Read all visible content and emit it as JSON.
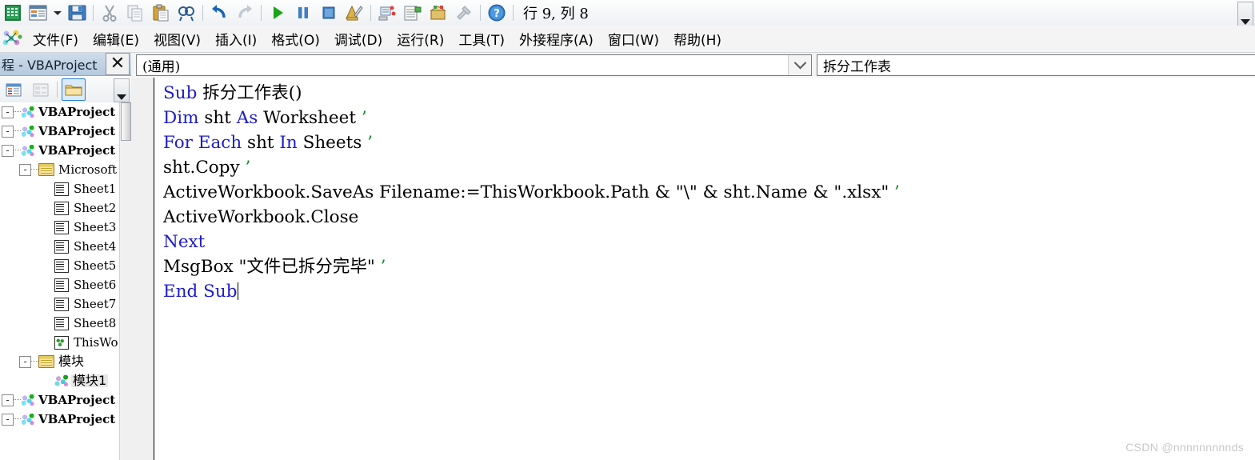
{
  "toolbar": {
    "buttons": [
      {
        "name": "excel-logo-icon",
        "glyph": "excel"
      },
      {
        "name": "view-microsoft-excel-icon",
        "glyph": "viewexcel"
      },
      {
        "name": "insert-dropdown-caret-icon",
        "glyph": "caret"
      },
      {
        "name": "save-icon",
        "glyph": "save"
      },
      {
        "name": "cut-icon",
        "glyph": "cut"
      },
      {
        "name": "copy-icon",
        "glyph": "copy"
      },
      {
        "name": "paste-icon",
        "glyph": "paste"
      },
      {
        "name": "find-icon",
        "glyph": "find"
      },
      {
        "name": "undo-icon",
        "glyph": "undo"
      },
      {
        "name": "redo-icon",
        "glyph": "redo"
      },
      {
        "name": "run-icon",
        "glyph": "run"
      },
      {
        "name": "break-icon",
        "glyph": "pause"
      },
      {
        "name": "reset-icon",
        "glyph": "stop"
      },
      {
        "name": "design-mode-icon",
        "glyph": "design"
      },
      {
        "name": "project-explorer-icon",
        "glyph": "projexp"
      },
      {
        "name": "properties-window-icon",
        "glyph": "props"
      },
      {
        "name": "object-browser-icon",
        "glyph": "objbrowser"
      },
      {
        "name": "toolbox-icon",
        "glyph": "toolbox"
      },
      {
        "name": "help-icon",
        "glyph": "help"
      }
    ],
    "position_text": "行 9, 列 8"
  },
  "menubar": {
    "items": [
      {
        "label": "文件(F)",
        "mnemonic": "F"
      },
      {
        "label": "编辑(E)",
        "mnemonic": "E"
      },
      {
        "label": "视图(V)",
        "mnemonic": "V"
      },
      {
        "label": "插入(I)",
        "mnemonic": "I"
      },
      {
        "label": "格式(O)",
        "mnemonic": "O"
      },
      {
        "label": "调试(D)",
        "mnemonic": "D"
      },
      {
        "label": "运行(R)",
        "mnemonic": "R"
      },
      {
        "label": "工具(T)",
        "mnemonic": "T"
      },
      {
        "label": "外接程序(A)",
        "mnemonic": "A"
      },
      {
        "label": "窗口(W)",
        "mnemonic": "W"
      },
      {
        "label": "帮助(H)",
        "mnemonic": "H"
      }
    ]
  },
  "project_explorer": {
    "title": "程 - VBAProject",
    "close_label": "✕",
    "toolbar_buttons": [
      {
        "name": "view-code-button",
        "selected": false
      },
      {
        "name": "view-object-button",
        "selected": false
      },
      {
        "name": "toggle-folders-button",
        "selected": true
      }
    ],
    "tree": [
      {
        "label": "VBAProject",
        "icon": "project",
        "indent": 0,
        "expander": "-",
        "bold": true,
        "selected": false
      },
      {
        "label": "VBAProject",
        "icon": "project",
        "indent": 0,
        "expander": "-",
        "bold": true,
        "selected": false
      },
      {
        "label": "VBAProject",
        "icon": "project",
        "indent": 0,
        "expander": "-",
        "bold": true,
        "selected": false
      },
      {
        "label": "Microsoft",
        "icon": "folder",
        "indent": 1,
        "expander": "-",
        "bold": false,
        "selected": false
      },
      {
        "label": "Sheet1",
        "icon": "sheet",
        "indent": 2,
        "expander": "",
        "bold": false,
        "selected": false
      },
      {
        "label": "Sheet2",
        "icon": "sheet",
        "indent": 2,
        "expander": "",
        "bold": false,
        "selected": false
      },
      {
        "label": "Sheet3",
        "icon": "sheet",
        "indent": 2,
        "expander": "",
        "bold": false,
        "selected": false
      },
      {
        "label": "Sheet4",
        "icon": "sheet",
        "indent": 2,
        "expander": "",
        "bold": false,
        "selected": false
      },
      {
        "label": "Sheet5",
        "icon": "sheet",
        "indent": 2,
        "expander": "",
        "bold": false,
        "selected": false
      },
      {
        "label": "Sheet6",
        "icon": "sheet",
        "indent": 2,
        "expander": "",
        "bold": false,
        "selected": false
      },
      {
        "label": "Sheet7",
        "icon": "sheet",
        "indent": 2,
        "expander": "",
        "bold": false,
        "selected": false
      },
      {
        "label": "Sheet8",
        "icon": "sheet",
        "indent": 2,
        "expander": "",
        "bold": false,
        "selected": false
      },
      {
        "label": "ThisWo",
        "icon": "workbook",
        "indent": 2,
        "expander": "",
        "bold": false,
        "selected": false
      },
      {
        "label": "模块",
        "icon": "folder",
        "indent": 1,
        "expander": "-",
        "bold": false,
        "selected": false,
        "cjk": true
      },
      {
        "label": "模块1",
        "icon": "module",
        "indent": 2,
        "expander": "",
        "bold": false,
        "selected": true,
        "cjk": true
      },
      {
        "label": "VBAProject",
        "icon": "project",
        "indent": 0,
        "expander": "-",
        "bold": true,
        "selected": false
      },
      {
        "label": "VBAProject",
        "icon": "project",
        "indent": 0,
        "expander": "-",
        "bold": true,
        "selected": false
      }
    ]
  },
  "code_pane": {
    "object_combo_value": "(通用)",
    "procedure_combo_value": "拆分工作表",
    "lines": [
      [
        {
          "t": "Sub ",
          "c": "kw"
        },
        {
          "t": "拆分工作表()",
          "c": ""
        }
      ],
      [
        {
          "t": "Dim ",
          "c": "kw"
        },
        {
          "t": "sht ",
          "c": ""
        },
        {
          "t": "As ",
          "c": "kw"
        },
        {
          "t": "Worksheet ",
          "c": ""
        },
        {
          "t": "’",
          "c": "cm"
        }
      ],
      [
        {
          "t": "For Each ",
          "c": "kw"
        },
        {
          "t": "sht ",
          "c": ""
        },
        {
          "t": "In ",
          "c": "kw"
        },
        {
          "t": "Sheets ",
          "c": ""
        },
        {
          "t": "’",
          "c": "cm"
        }
      ],
      [
        {
          "t": "sht.Copy ",
          "c": ""
        },
        {
          "t": "’",
          "c": "cm"
        }
      ],
      [
        {
          "t": "ActiveWorkbook.SaveAs Filename:=ThisWorkbook.Path & \"\\\" & sht.Name & \".xlsx\" ",
          "c": ""
        },
        {
          "t": "’",
          "c": "cm"
        }
      ],
      [
        {
          "t": "ActiveWorkbook.Close",
          "c": ""
        }
      ],
      [
        {
          "t": "Next",
          "c": "kw"
        }
      ],
      [
        {
          "t": "MsgBox \"文件已拆分完毕\" ",
          "c": ""
        },
        {
          "t": "’",
          "c": "cm"
        }
      ],
      [
        {
          "t": "End Sub",
          "c": "kw"
        },
        {
          "t": "|CARET|",
          "c": "caret"
        }
      ]
    ]
  },
  "watermark": "CSDN @nnnnnnnnnds"
}
